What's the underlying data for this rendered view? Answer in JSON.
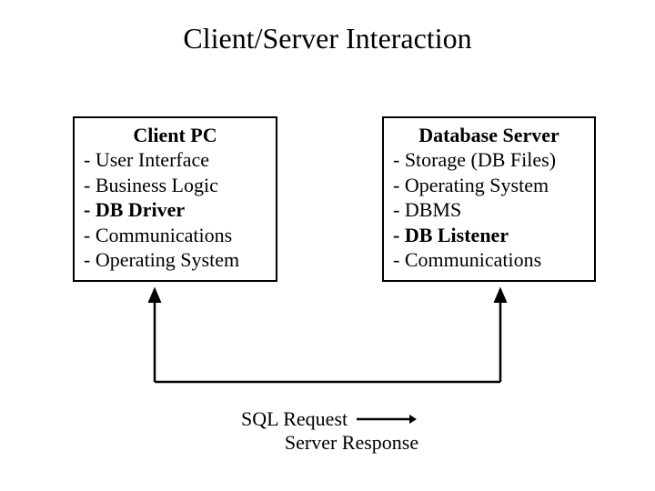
{
  "title": "Client/Server Interaction",
  "client": {
    "title": "Client PC",
    "items": [
      {
        "text": "- User Interface",
        "bold": false
      },
      {
        "text": "- Business Logic",
        "bold": false
      },
      {
        "text": "- DB Driver",
        "bold": true
      },
      {
        "text": "- Communications",
        "bold": false
      },
      {
        "text": "- Operating System",
        "bold": false
      }
    ]
  },
  "server": {
    "title": "Database Server",
    "items": [
      {
        "text": "- Storage (DB Files)",
        "bold": false
      },
      {
        "text": "- Operating System",
        "bold": false
      },
      {
        "text": "- DBMS",
        "bold": false
      },
      {
        "text": "- DB Listener",
        "bold": true
      },
      {
        "text": "- Communications",
        "bold": false
      }
    ]
  },
  "legend": {
    "request": "SQL Request",
    "response": "Server Response"
  }
}
